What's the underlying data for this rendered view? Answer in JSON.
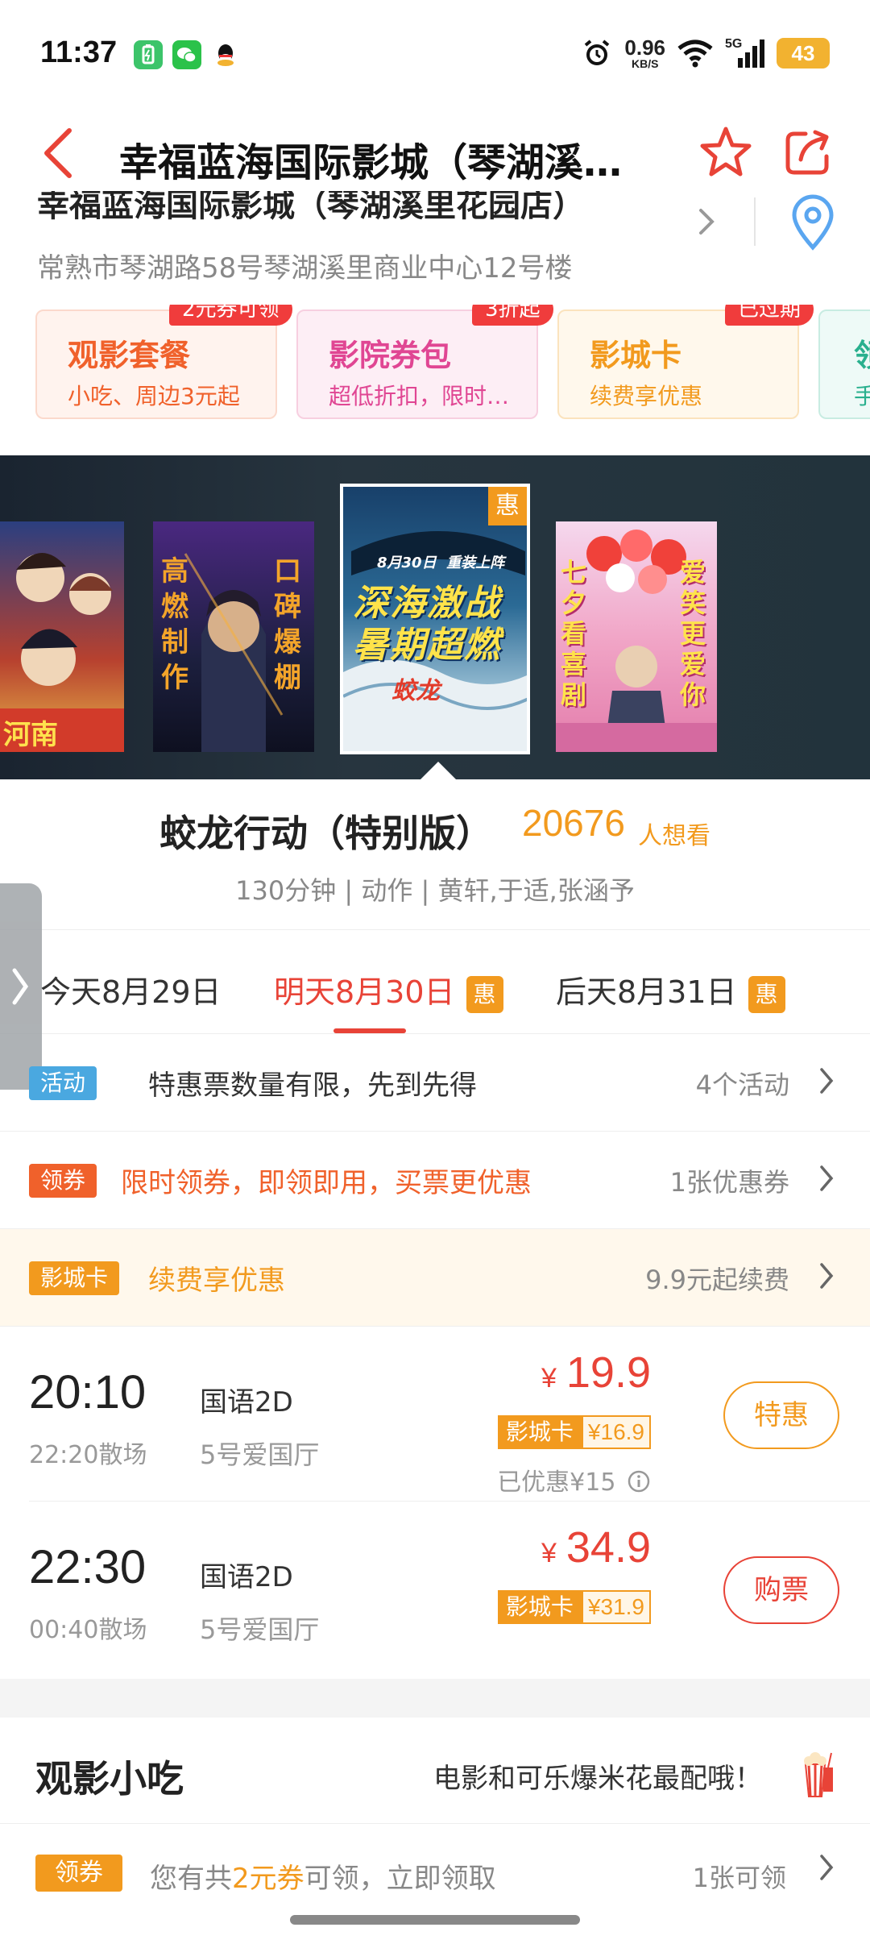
{
  "status_bar": {
    "time": "11:37",
    "net_speed": "0.96",
    "net_unit": "KB/S",
    "network": "5G",
    "battery": "43"
  },
  "nav": {
    "title": "幸福蓝海国际影城（琴湖溪里花园店）"
  },
  "cinema": {
    "name": "幸福蓝海国际影城（琴湖溪里花园店）",
    "address": "常熟市琴湖路58号琴湖溪里商业中心12号楼"
  },
  "cards": [
    {
      "title": "观影套餐",
      "subtitle": "小吃、周边3元起",
      "badge": "2元券可领"
    },
    {
      "title": "影院券包",
      "subtitle": "超低折扣，限时抢购",
      "badge": "3折起"
    },
    {
      "title": "影城卡",
      "subtitle": "续费享优惠",
      "badge": "已过期"
    },
    {
      "title": "领",
      "subtitle": "手"
    }
  ],
  "posters": {
    "p2_left": [
      "高",
      "燃",
      "制",
      "作"
    ],
    "p2_right": [
      "口",
      "碑",
      "爆",
      "棚"
    ],
    "p3_date": "8月30日",
    "p3_tag": "重装上阵",
    "p3_line1": "深海激战",
    "p3_line2": "暑期超燃",
    "p3_hui": "惠",
    "p4_left": [
      "七",
      "夕",
      "看",
      "喜",
      "剧"
    ],
    "p4_right": [
      "爱",
      "笑",
      "更",
      "爱",
      "你"
    ]
  },
  "movie": {
    "title": "蛟龙行动（特别版）",
    "want_count": "20676",
    "want_label": "人想看",
    "meta": "130分钟 | 动作 | 黄轩,于适,张涵予"
  },
  "dates": [
    {
      "label": "今天8月29日",
      "hui": ""
    },
    {
      "label": "明天8月30日",
      "hui": "惠"
    },
    {
      "label": "后天8月31日",
      "hui": "惠"
    }
  ],
  "promos": {
    "activity": {
      "tag": "活动",
      "text": "特惠票数量有限，先到先得",
      "right": "4个活动"
    },
    "coupon": {
      "tag": "领券",
      "text": "限时领券，即领即用，买票更优惠",
      "right": "1张优惠券"
    },
    "card": {
      "tag": "影城卡",
      "text": "续费享优惠",
      "right": "9.9元起续费"
    }
  },
  "showtimes": [
    {
      "time": "20:10",
      "end": "22:20散场",
      "lang": "国语2D",
      "hall": "5号爱国厅",
      "yen": "¥",
      "price": "19.9",
      "card_label": "影城卡",
      "card_price": "¥16.9",
      "discount": "已优惠¥15",
      "button": "特惠"
    },
    {
      "time": "22:30",
      "end": "00:40散场",
      "lang": "国语2D",
      "hall": "5号爱国厅",
      "yen": "¥",
      "price": "34.9",
      "card_label": "影城卡",
      "card_price": "¥31.9",
      "discount": "",
      "button": "购票"
    }
  ],
  "snack": {
    "title": "观影小吃",
    "slogan": "电影和可乐爆米花最配哦！"
  },
  "coupon_bar": {
    "tag": "领券",
    "text_pre": "您有共",
    "text_hl": "2元券",
    "text_post": "可领，立即领取",
    "right": "1张可领"
  },
  "colors": {
    "accent_red": "#e84337",
    "accent_orange": "#f29a1e"
  }
}
